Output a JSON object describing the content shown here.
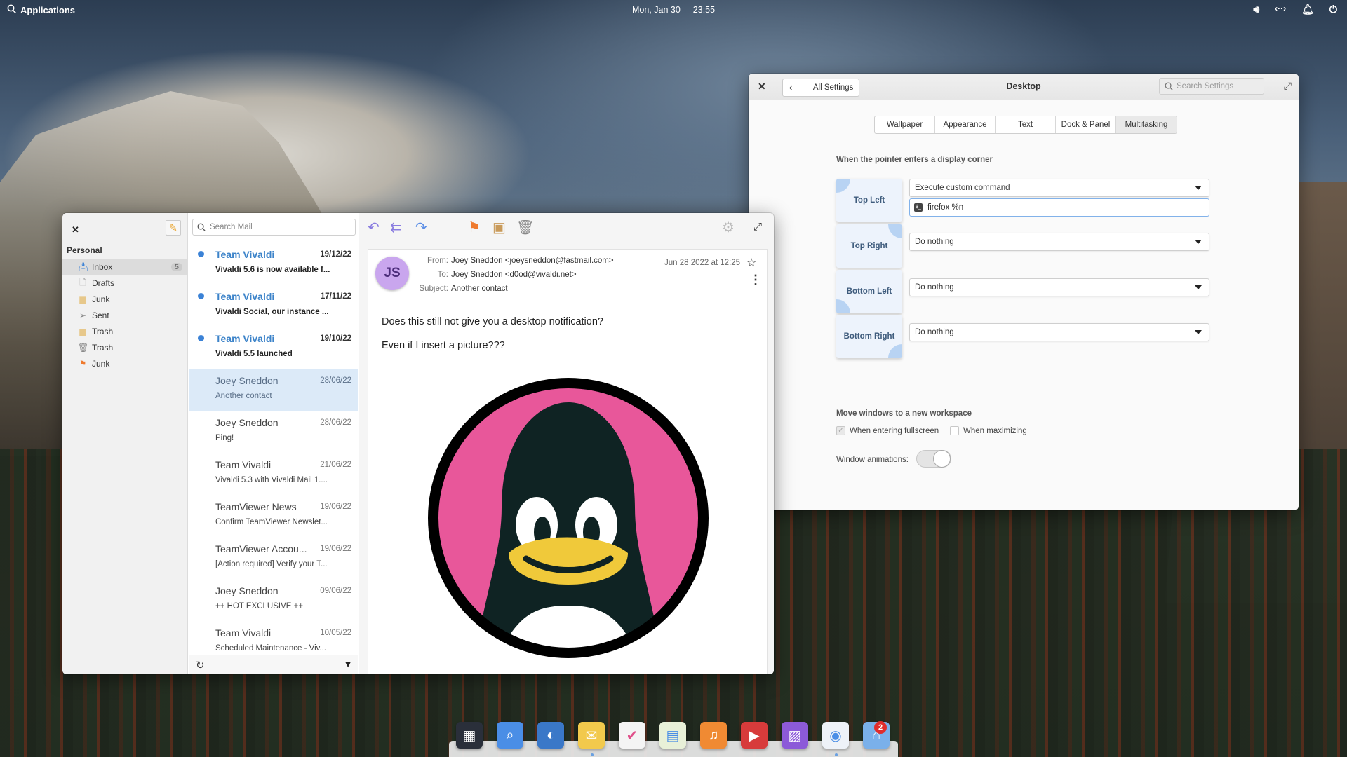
{
  "topbar": {
    "applications_label": "Applications",
    "date": "Mon, Jan 30",
    "time": "23:55",
    "indicators": [
      "volume-icon",
      "network-icon",
      "notifications-icon",
      "power-icon"
    ]
  },
  "settings": {
    "back_label": "All Settings",
    "title": "Desktop",
    "search_placeholder": "Search Settings",
    "tabs": [
      "Wallpaper",
      "Appearance",
      "Text",
      "Dock & Panel",
      "Multitasking"
    ],
    "active_tab": "Multitasking",
    "corners_heading": "When the pointer enters a display corner",
    "corners": [
      {
        "label": "Top Left",
        "action": "Execute custom command",
        "command": "firefox %n"
      },
      {
        "label": "Top Right",
        "action": "Do nothing"
      },
      {
        "label": "Bottom Left",
        "action": "Do nothing"
      },
      {
        "label": "Bottom Right",
        "action": "Do nothing"
      }
    ],
    "workspace_heading": "Move windows to a new workspace",
    "checkbox_fullscreen": {
      "label": "When entering fullscreen",
      "checked": true
    },
    "checkbox_maximizing": {
      "label": "When maximizing",
      "checked": false
    },
    "animations_label": "Window animations:",
    "animations_on": false
  },
  "mail": {
    "account": "Personal",
    "folders": [
      {
        "name": "Inbox",
        "icon": "inbox-icon",
        "count": "5",
        "active": true
      },
      {
        "name": "Drafts",
        "icon": "drafts-icon"
      },
      {
        "name": "Junk",
        "icon": "folder-icon"
      },
      {
        "name": "Sent",
        "icon": "sent-icon"
      },
      {
        "name": "Trash",
        "icon": "folder-icon"
      },
      {
        "name": "Trash",
        "icon": "trash-icon"
      },
      {
        "name": "Junk",
        "icon": "flag-icon"
      }
    ],
    "search_placeholder": "Search Mail",
    "messages": [
      {
        "from": "Team Vivaldi",
        "date": "19/12/22",
        "subject": "Vivaldi 5.6 is now available f...",
        "unread": true
      },
      {
        "from": "Team Vivaldi",
        "date": "17/11/22",
        "subject": "Vivaldi Social, our instance ...",
        "unread": true
      },
      {
        "from": "Team Vivaldi",
        "date": "19/10/22",
        "subject": "Vivaldi 5.5 launched",
        "unread": true
      },
      {
        "from": "Joey Sneddon",
        "date": "28/06/22",
        "subject": "Another contact",
        "selected": true
      },
      {
        "from": "Joey Sneddon",
        "date": "28/06/22",
        "subject": "Ping!"
      },
      {
        "from": "Team Vivaldi",
        "date": "21/06/22",
        "subject": "Vivaldi 5.3 with Vivaldi Mail 1...."
      },
      {
        "from": "TeamViewer News",
        "date": "19/06/22",
        "subject": "Confirm TeamViewer Newslet..."
      },
      {
        "from": "TeamViewer Accou...",
        "date": "19/06/22",
        "subject": "[Action required] Verify your T..."
      },
      {
        "from": "Joey Sneddon",
        "date": "09/06/22",
        "subject": "++ HOT EXCLUSIVE ++"
      },
      {
        "from": "Team Vivaldi",
        "date": "10/05/22",
        "subject": "Scheduled Maintenance - Viv..."
      }
    ],
    "reader": {
      "avatar_initials": "JS",
      "from_label": "From:",
      "from": "Joey Sneddon <joeysneddon@fastmail.com>",
      "to_label": "To:",
      "to": "Joey Sneddon <d0od@vivaldi.net>",
      "subject_label": "Subject:",
      "subject": "Another contact",
      "date": "Jun 28 2022 at 12:25",
      "body_line1": "Does this still not give you a desktop notification?",
      "body_line2": "Even if I insert a picture???"
    }
  },
  "dock": {
    "apps": [
      "Multitasking View",
      "Files",
      "Web Browser",
      "Mail",
      "Tasks",
      "Calendar",
      "Music",
      "Videos",
      "Photos",
      "System Settings",
      "AppCenter"
    ],
    "appcenter_badge": "2"
  },
  "colors": {
    "accent": "#3c83c9",
    "selected_row": "#dceaf8",
    "avatar": "#c9a6ee",
    "tux_pink": "#e8579a",
    "tux_yellow": "#f0c93a"
  }
}
